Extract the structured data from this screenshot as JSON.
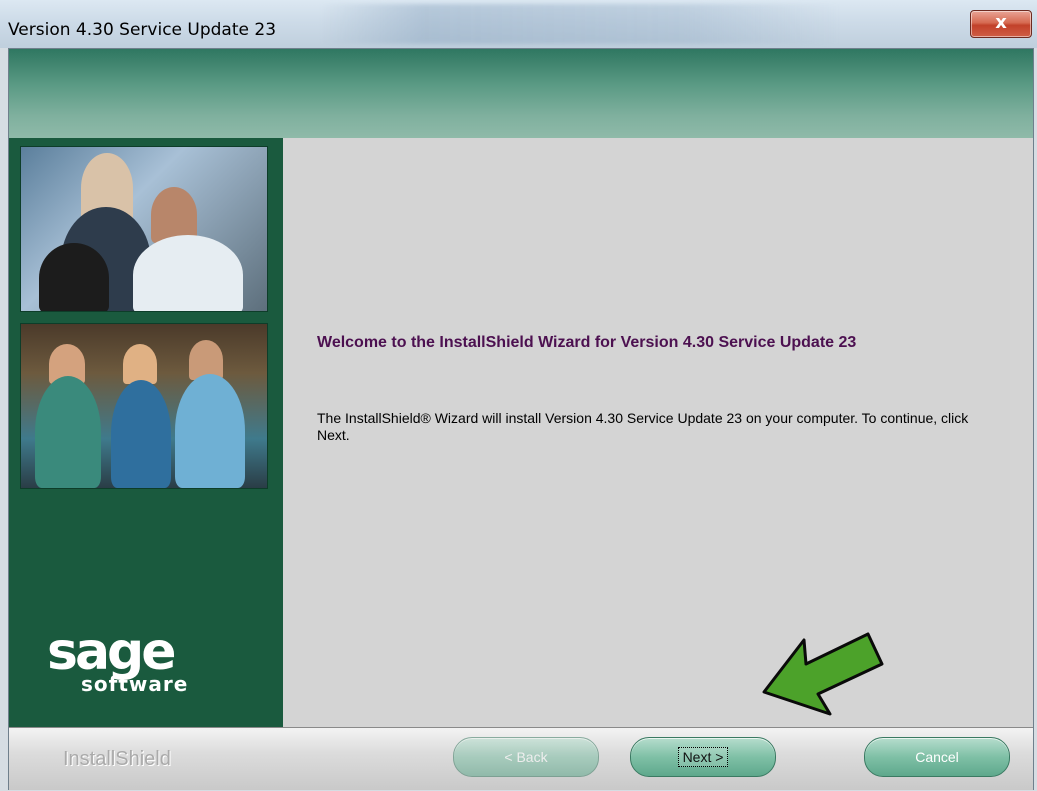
{
  "window": {
    "title": "Version 4.30 Service Update 23",
    "close_label": "x"
  },
  "wizard": {
    "welcome_heading": "Welcome to the InstallShield Wizard for Version 4.30 Service Update 23",
    "description": "The InstallShield® Wizard will install Version 4.30 Service Update 23 on your computer.  To continue, click Next."
  },
  "branding": {
    "logo_main": "sage",
    "logo_sub": "software",
    "installer_brand": "InstallShield"
  },
  "buttons": {
    "back": "< Back",
    "next": "Next >",
    "cancel": "Cancel"
  },
  "colors": {
    "accent_green": "#1a5a3e",
    "heading_purple": "#4c1050",
    "arrow_green": "#4ca22a"
  },
  "icons": {
    "arrow": "pointer-arrow-icon",
    "close": "close-icon"
  }
}
